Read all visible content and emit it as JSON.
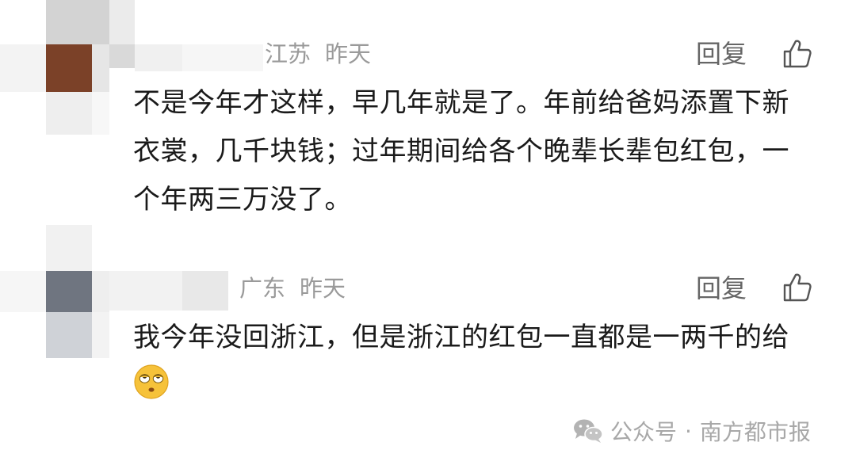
{
  "comments": [
    {
      "region": "江苏",
      "time": "昨天",
      "reply_label": "回复",
      "text": "不是今年才这样，早几年就是了。年前给爸妈添置下新衣裳，几千块钱；过年期间给各个晚辈长辈包红包，一个年两三万没了。",
      "avatar_accent": "#7b4128"
    },
    {
      "region": "广东",
      "time": "昨天",
      "reply_label": "回复",
      "text": "我今年没回浙江，但是浙江的红包一直都是一两千的给",
      "emoji": "rolling-eyes-emoji",
      "avatar_accent": "#6f7580"
    }
  ],
  "watermark": {
    "platform": "公众号",
    "separator": "·",
    "account": "南方都市报"
  },
  "icons": {
    "like": "thumbs-up-icon",
    "wechat": "wechat-icon"
  },
  "colors": {
    "meta_gray": "#9a9a9a",
    "text_dark": "#1a1a1a",
    "reply_gray": "#666666"
  }
}
